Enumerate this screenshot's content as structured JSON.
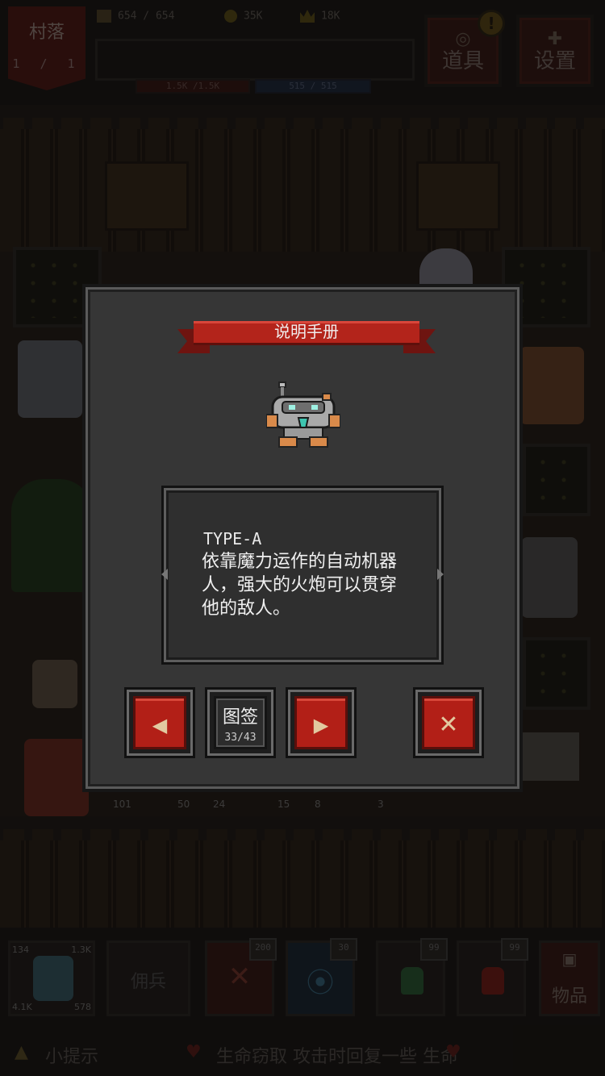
{
  "hud": {
    "village_name": "村落",
    "village_level": "1 / 1",
    "food": "654 / 654",
    "gold": "35K",
    "crown": "18K",
    "hp": "1.5K /1.5K",
    "mp": "515 / 515",
    "items_button": "道具",
    "settings_button": "设置",
    "alert": "!"
  },
  "modal": {
    "title": "说明手册",
    "entry_name": "TYPE-A",
    "entry_description": "依靠魔力运作的自动机器人，强大的火炮可以贯穿他的敌人。",
    "prev_glyph": "◀",
    "next_glyph": "▶",
    "close_glyph": "✕",
    "collection_label": "图签",
    "collection_count": "33/43"
  },
  "world_labels": {
    "counts": [
      "101",
      "50",
      "24",
      "15",
      "8",
      "3"
    ]
  },
  "bottom": {
    "hero_stats": [
      "134",
      "1.3K",
      "4.1K",
      "578"
    ],
    "mercenary_label": "佣兵",
    "skill_badges": [
      "200",
      "30"
    ],
    "potion_badges": [
      "99",
      "99"
    ],
    "items_label": "物品",
    "hint_label": "小提示",
    "hint_text": "生命窃取 攻击时回复一些 生命"
  },
  "colors": {
    "accent_red": "#b21f17",
    "panel_gray": "#363636"
  }
}
